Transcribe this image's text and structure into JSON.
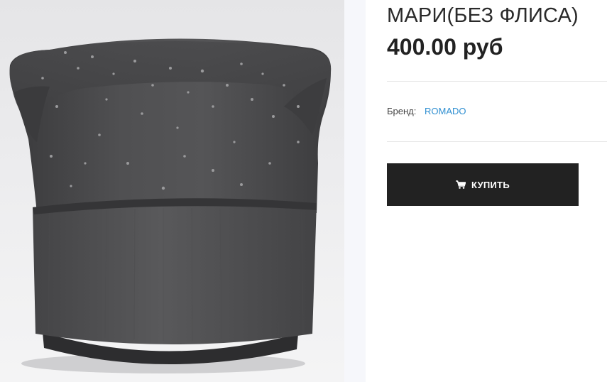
{
  "product": {
    "title": "МАРИ(БЕЗ ФЛИСА)",
    "price": "400.00 руб",
    "image": {
      "icon": "beanie-hat-photo"
    },
    "brand": {
      "label": "Бренд:",
      "value": "ROMADO",
      "link_color": "#2f8fd1"
    },
    "buy_button": {
      "label": "КУПИТЬ",
      "icon": "cart-icon",
      "background": "#222222"
    }
  }
}
